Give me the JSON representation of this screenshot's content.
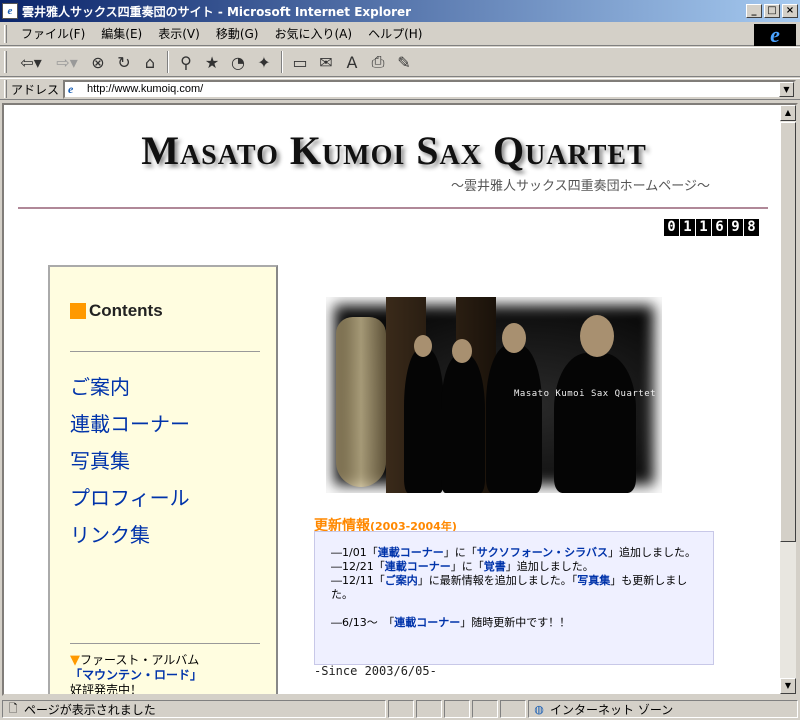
{
  "window": {
    "title": "雲井雅人サックス四重奏団のサイト - Microsoft Internet Explorer",
    "icon": "ie-page-icon",
    "minimize": "_",
    "maximize": "□",
    "close": "×"
  },
  "menu": {
    "items": [
      "ファイル(F)",
      "編集(E)",
      "表示(V)",
      "移動(G)",
      "お気に入り(A)",
      "ヘルプ(H)"
    ]
  },
  "toolbar": {
    "buttons": [
      "back-icon",
      "forward-icon",
      "stop-icon",
      "refresh-icon",
      "home-icon",
      "search-icon",
      "favorites-icon",
      "history-icon",
      "channels-icon",
      "fullscreen-icon",
      "mail-icon",
      "font-icon",
      "print-icon",
      "edit-icon"
    ]
  },
  "address": {
    "label": "アドレス",
    "url": "http://www.kumoiq.com/"
  },
  "page": {
    "title": "Masato Kumoi Sax Quartet",
    "subtitle": "〜雲井雅人サックス四重奏団ホームページ〜",
    "counter": [
      "0",
      "1",
      "1",
      "6",
      "9",
      "8"
    ],
    "sidebar": {
      "heading": "Contents",
      "nav": [
        "ご案内",
        "連載コーナー",
        "写真集",
        "プロフィール",
        "リンク集"
      ],
      "album": {
        "label": "ファースト・アルバム",
        "link": "「マウンテン・ロード」",
        "status": "好評発売中！"
      }
    },
    "photo_caption": "Masato Kumoi Sax Quartet",
    "news": {
      "title": "更新情報",
      "years": "(2003-2004年)",
      "items": [
        {
          "prefix": "―1/01「",
          "link1": "連載コーナー",
          "mid": "」に「",
          "link2": "サクソフォーン・シラバス",
          "suffix": "」追加しました。"
        },
        {
          "prefix": "―12/21「",
          "link1": "連載コーナー",
          "mid": "」に「",
          "link2": "覚書",
          "suffix": "」追加しました。"
        },
        {
          "prefix": "―12/11「",
          "link1": "ご案内",
          "mid": "」に最新情報を追加しました。「",
          "link2": "写真集",
          "suffix": "」も更新しました。"
        }
      ],
      "footer_prefix": "―6/13〜　「",
      "footer_link": "連載コーナー",
      "footer_suffix": "」随時更新中です！！"
    },
    "since": "-Since 2003/6/05-"
  },
  "status": {
    "text": "ページが表示されました",
    "zone": "インターネット ゾーン"
  },
  "colors": {
    "accent_orange": "#ff9900",
    "link_blue": "#0033aa",
    "sidebar_bg": "#fffde0",
    "news_bg": "#eff0ff"
  }
}
